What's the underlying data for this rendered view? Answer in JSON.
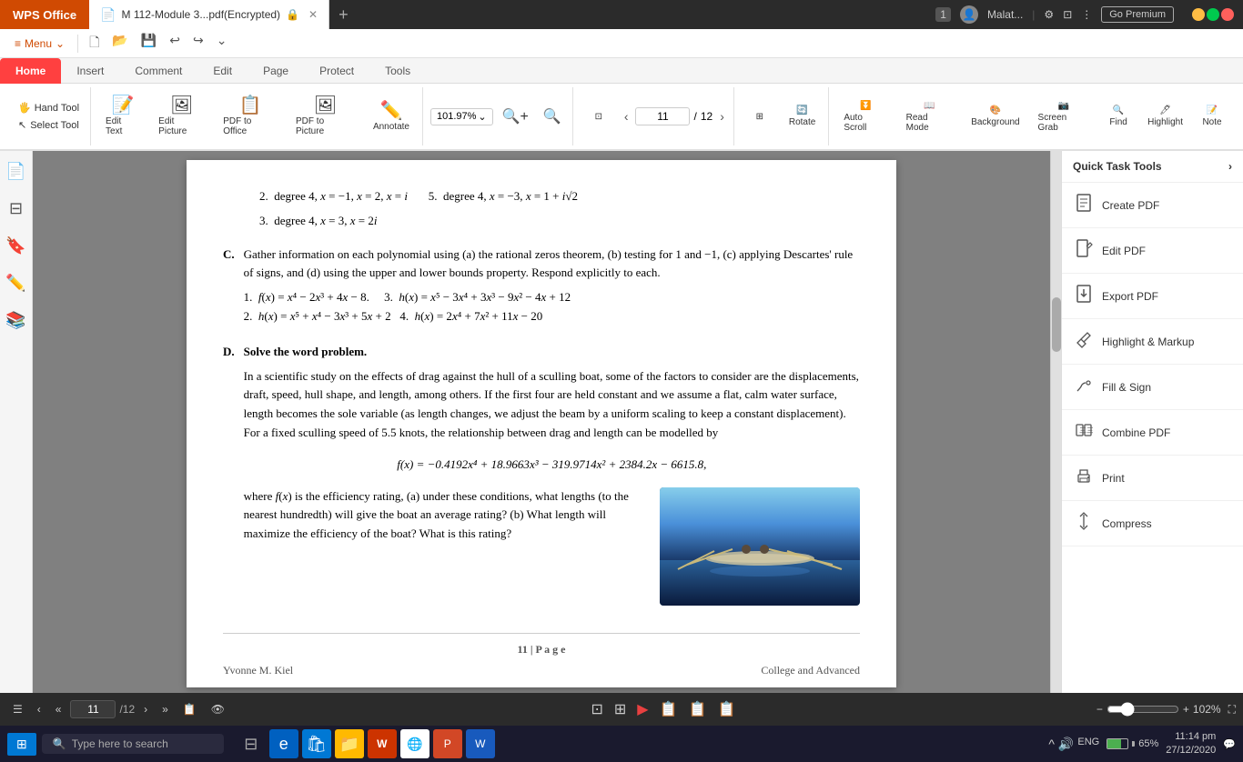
{
  "titlebar": {
    "wps_label": "WPS Office",
    "tab_title": "M 112-Module 3...pdf(Encrypted)",
    "tab_icon": "📄",
    "add_tab": "+",
    "user": "Malat...",
    "premium_label": "Go Premium",
    "window_num": "1"
  },
  "menubar": {
    "menu_icon": "≡",
    "menu_label": "Menu",
    "items": [
      "↩",
      "↪",
      "⌄"
    ]
  },
  "ribbon": {
    "tabs": [
      "Home",
      "Insert",
      "Comment",
      "Edit",
      "Page",
      "Protect",
      "Tools"
    ],
    "active_tab": "Home",
    "zoom": "101.97%",
    "page_current": "11",
    "page_total": "12",
    "tools": {
      "hand_tool": "Hand Tool",
      "select_tool": "Select Tool",
      "edit_text": "Edit Text",
      "edit_picture": "Edit Picture",
      "pdf_to_office": "PDF to Office",
      "pdf_to_picture": "PDF to Picture",
      "annotate": "Annotate",
      "rotate": "Rotate",
      "auto_scroll": "Auto Scroll",
      "read_mode": "Read Mode",
      "background": "Background",
      "screen_grab": "Screen Grab",
      "find": "Find",
      "highlight": "Highlight",
      "note": "Note"
    }
  },
  "content": {
    "sections": {
      "section_b": {
        "items": [
          "degree 4, x = −1, x = 2, x = i    5. degree 4, x = −3, x = 1 + i√2",
          "degree 4, x = 3, x = 2i"
        ]
      },
      "section_c": {
        "label": "C.",
        "text": "Gather information on each polynomial using (a) the rational zeros theorem, (b) testing for 1 and −1, (c) applying Descartes' rule of signs, and (d) using the upper and lower bounds property. Respond explicitly to each.",
        "items": [
          "f(x) = x⁴ − 2x³ + 4x − 8.    3. h(x) = x⁵ − 3x⁴ + 3x³ − 9x² − 4x + 12",
          "h(x) = x⁵ + x⁴ − 3x³ + 5x + 2  4. h(x) = 2x⁴ + 7x² + 11x − 20"
        ]
      },
      "section_d": {
        "label": "D.",
        "title": "Solve the word problem.",
        "text1": "In a scientific study on the effects of drag against the hull of a sculling boat, some of the factors to consider are the displacements, draft, speed, hull shape, and length, among others. If the first four are held constant and we assume a flat, calm water surface, length becomes the sole variable (as length changes, we adjust the beam by a uniform scaling to keep a constant displacement). For a fixed sculling speed of 5.5 knots, the relationship between drag and length can be modelled by",
        "formula": "f(x) = −0.4192x⁴ + 18.9663x³ − 319.9714x² + 2384.2x − 6615.8,",
        "text2": "where f(x) is the efficiency rating, (a) under these conditions, what lengths (to the nearest hundredth) will give the boat an average rating? (b) What length will maximize the efficiency of the boat? What is this rating?"
      }
    },
    "footer": {
      "page_num": "11 | P a g e",
      "author": "Yvonne M. Kiel",
      "subject": "College and Advanced"
    }
  },
  "right_panel": {
    "title": "Quick Task Tools",
    "expand_icon": "›",
    "items": [
      {
        "id": "create-pdf",
        "icon": "📄",
        "label": "Create PDF"
      },
      {
        "id": "edit-pdf",
        "icon": "✏️",
        "label": "Edit PDF"
      },
      {
        "id": "export-pdf",
        "icon": "📤",
        "label": "Export PDF"
      },
      {
        "id": "highlight-markup",
        "icon": "🖊",
        "label": "Highlight & Markup"
      },
      {
        "id": "fill-sign",
        "icon": "✒️",
        "label": "Fill & Sign"
      },
      {
        "id": "combine-pdf",
        "icon": "⊞",
        "label": "Combine PDF"
      },
      {
        "id": "print",
        "icon": "🖨",
        "label": "Print"
      },
      {
        "id": "compress",
        "icon": "🗜",
        "label": "Compress"
      }
    ]
  },
  "statusbar": {
    "page_display": "11/12",
    "zoom_level": "102%",
    "icons": [
      "📋",
      "👁",
      "⊡",
      "⊞",
      "▶",
      "📋",
      "📋",
      "📋"
    ]
  },
  "taskbar": {
    "search_placeholder": "Type here to search",
    "time": "11:14 pm",
    "date": "27/12/2020",
    "battery": "65%",
    "lang": "ENG"
  }
}
